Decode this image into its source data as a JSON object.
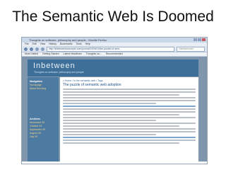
{
  "slide": {
    "title": "The Semantic Web Is Doomed"
  },
  "browser": {
    "window_title": "Thoughts on software, philosophy and people - Mozilla Firefox",
    "menu": [
      "File",
      "Edit",
      "View",
      "History",
      "Bookmarks",
      "Tools",
      "Help"
    ],
    "address": "http://inbetweenconcepts.com/journal/2009/11/the-puzzle-of-sem...",
    "search_placeholder": "inbetweennet",
    "bookmarks": [
      "Most Visited",
      "Getting Started",
      "Latest Headlines",
      "Thoughts on...",
      "Recommended"
    ]
  },
  "blog": {
    "name": "Inbetween",
    "tagline": "Thoughts on software, philosophy and people",
    "sidebar": {
      "nav_header": "Navigation",
      "nav_items": [
        "Homepage",
        "About this blog"
      ],
      "archive_header": "Archives",
      "archives": [
        "November 09",
        "October 09",
        "September 09",
        "August 09",
        "July 09"
      ]
    },
    "post": {
      "meta": "« Home / In the semantic web / Tags",
      "title": "The puzzle of semantic web adoption"
    }
  }
}
